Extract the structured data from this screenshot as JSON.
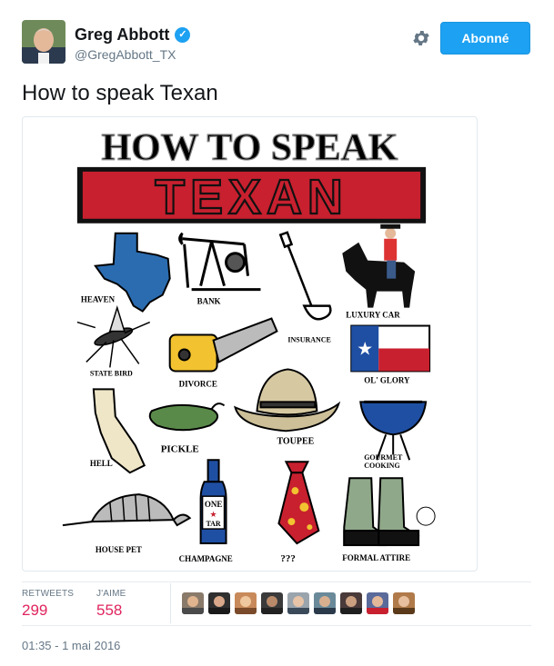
{
  "user": {
    "name": "Greg Abbott",
    "handle": "@GregAbbott_TX",
    "verified_icon": "verified-badge-icon",
    "follow_label": "Abonné",
    "settings_icon": "gear-icon"
  },
  "tweet": {
    "text": "How to speak Texan"
  },
  "image": {
    "title_top": "HOW TO SPEAK",
    "title_main": "TEXAN",
    "labels": {
      "heaven": "HEAVEN",
      "bank": "BANK",
      "insurance": "INSURANCE",
      "luxury_car": "LUXURY CAR",
      "state_bird": "STATE BIRD",
      "divorce": "DIVORCE",
      "ol_glory": "OL' GLORY",
      "hell": "HELL",
      "pickle": "PICKLE",
      "toupee": "TOUPEE",
      "gourmet": "GOURMET",
      "cooking": "COOKING",
      "house_pet": "HOUSE PET",
      "champagne": "CHAMPAGNE",
      "question": "???",
      "formal_attire": "FORMAL ATTIRE",
      "bottle_one": "ONE",
      "bottle_tar": "TAR"
    }
  },
  "stats": {
    "retweets_label": "RETWEETS",
    "retweets_value": "299",
    "likes_label": "J'AIME",
    "likes_value": "558"
  },
  "timestamp": "01:35 - 1 mai 2016",
  "colors": {
    "accent": "#1da1f2",
    "count": "#e0245e",
    "muted": "#657786",
    "texan_red": "#c8202f"
  }
}
